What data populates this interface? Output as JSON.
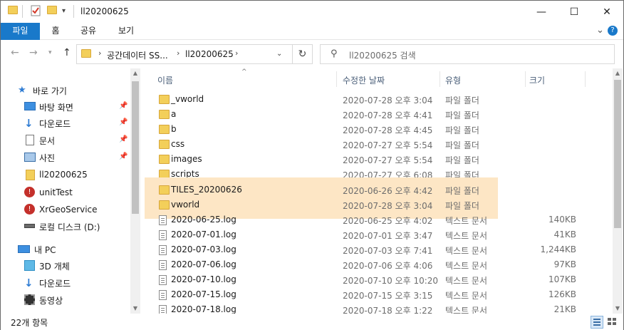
{
  "window": {
    "title": "ll20200625",
    "minimize_glyph": "—",
    "maximize_glyph": "☐",
    "close_glyph": "✕"
  },
  "ribbon": {
    "tabs": [
      "파일",
      "홈",
      "공유",
      "보기"
    ],
    "expand_glyph": "⌄",
    "help_glyph": "?"
  },
  "address": {
    "crumbs": [
      "공간데이터 SS...",
      "ll20200625"
    ],
    "refresh_glyph": "↻"
  },
  "search": {
    "placeholder": "ll20200625 검색",
    "glyph": "⚲"
  },
  "nav": {
    "quick_access": "바로 가기",
    "items": [
      {
        "label": "바탕 화면",
        "icon": "desktop-icon",
        "pinned": true
      },
      {
        "label": "다운로드",
        "icon": "download-icon",
        "pinned": true
      },
      {
        "label": "문서",
        "icon": "document-icon",
        "pinned": true
      },
      {
        "label": "사진",
        "icon": "picture-icon",
        "pinned": true
      },
      {
        "label": "ll20200625",
        "icon": "folder-icon",
        "pinned": false
      },
      {
        "label": "unitTest",
        "icon": "folder-error-icon",
        "pinned": false
      },
      {
        "label": "XrGeoService",
        "icon": "folder-error-icon",
        "pinned": false
      },
      {
        "label": "로컬 디스크 (D:)",
        "icon": "drive-icon",
        "pinned": false
      }
    ],
    "this_pc": "내 PC",
    "pc_items": [
      {
        "label": "3D 개체",
        "icon": "cube-3d-icon"
      },
      {
        "label": "다운로드",
        "icon": "download-icon"
      },
      {
        "label": "동영상",
        "icon": "video-icon"
      }
    ]
  },
  "columns": {
    "name": "이름",
    "date": "수정한 날짜",
    "type": "유형",
    "size": "크기",
    "sort_caret": "^"
  },
  "files": [
    {
      "name": "_vworld",
      "date": "2020-07-28 오후 3:04",
      "type": "파일 폴더",
      "size": "",
      "kind": "folder",
      "selected": false
    },
    {
      "name": "a",
      "date": "2020-07-28 오후 4:41",
      "type": "파일 폴더",
      "size": "",
      "kind": "folder",
      "selected": false
    },
    {
      "name": "b",
      "date": "2020-07-28 오후 4:45",
      "type": "파일 폴더",
      "size": "",
      "kind": "folder",
      "selected": false
    },
    {
      "name": "css",
      "date": "2020-07-27 오후 5:54",
      "type": "파일 폴더",
      "size": "",
      "kind": "folder",
      "selected": false
    },
    {
      "name": "images",
      "date": "2020-07-27 오후 5:54",
      "type": "파일 폴더",
      "size": "",
      "kind": "folder",
      "selected": false
    },
    {
      "name": "scripts",
      "date": "2020-07-27 오후 6:08",
      "type": "파일 폴더",
      "size": "",
      "kind": "folder",
      "selected": false
    },
    {
      "name": "TILES_20200626",
      "date": "2020-06-26 오후 4:42",
      "type": "파일 폴더",
      "size": "",
      "kind": "folder",
      "selected": true
    },
    {
      "name": "vworld",
      "date": "2020-07-28 오후 3:04",
      "type": "파일 폴더",
      "size": "",
      "kind": "folder",
      "selected": true
    },
    {
      "name": "2020-06-25.log",
      "date": "2020-06-25 오후 4:02",
      "type": "텍스트 문서",
      "size": "140KB",
      "kind": "file",
      "selected": false
    },
    {
      "name": "2020-07-01.log",
      "date": "2020-07-01 오후 3:47",
      "type": "텍스트 문서",
      "size": "41KB",
      "kind": "file",
      "selected": false
    },
    {
      "name": "2020-07-03.log",
      "date": "2020-07-03 오후 7:41",
      "type": "텍스트 문서",
      "size": "1,244KB",
      "kind": "file",
      "selected": false
    },
    {
      "name": "2020-07-06.log",
      "date": "2020-07-06 오후 4:06",
      "type": "텍스트 문서",
      "size": "97KB",
      "kind": "file",
      "selected": false
    },
    {
      "name": "2020-07-10.log",
      "date": "2020-07-10 오후 10:20",
      "type": "텍스트 문서",
      "size": "107KB",
      "kind": "file",
      "selected": false
    },
    {
      "name": "2020-07-15.log",
      "date": "2020-07-15 오후 3:15",
      "type": "텍스트 문서",
      "size": "126KB",
      "kind": "file",
      "selected": false
    },
    {
      "name": "2020-07-18.log",
      "date": "2020-07-18 오후 1:22",
      "type": "텍스트 문서",
      "size": "21KB",
      "kind": "file",
      "selected": false
    }
  ],
  "status": {
    "item_count": "22개 항목"
  },
  "colors": {
    "accent": "#1979ca",
    "selection": "#fde6c5",
    "folder": "#f3cf5a"
  }
}
